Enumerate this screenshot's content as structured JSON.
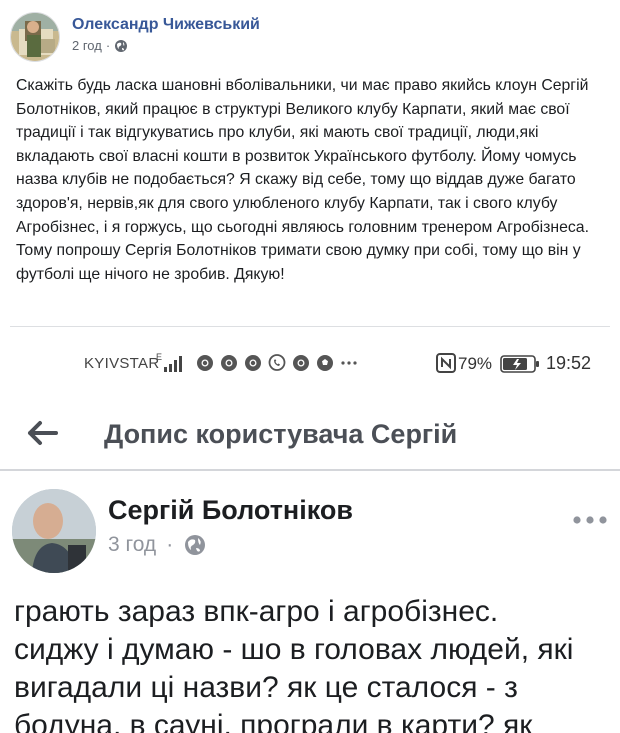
{
  "post": {
    "author": "Олександр Чижевський",
    "time": "2 год",
    "separator": "·",
    "privacy_icon": "globe-icon",
    "text": "Скажіть будь ласка шановні вболівальники, чи має право якийсь клоун Сергій Болотніков, який працює в структурі Великого клубу Карпати, який має свої традиції і так відгукуватись про клуби, які мають свої традиції, люди,які вкладають свої власні кошти в розвиток Українського футболу. Йому чомусь назва клубів не подобається? Я скажу від себе, тому що віддав дуже багато здоров'я, нервів,як для свого улюбленого клубу Карпати, так і свого клубу Агробізнес, і я горжусь, що сьогодні являюсь головним тренером Агробізнеса. Тому попрошу Сергія Болотніков тримати свою думку при собі, тому що він у футболі ще нічого не зробив. Дякую!"
  },
  "screenshot": {
    "status_bar": {
      "carrier": "KYIVSTAR",
      "network": "E",
      "battery": "79%",
      "time": "19:52"
    },
    "header": {
      "title": "Допис користувача Сергій"
    },
    "inner_post": {
      "author": "Сергій Болотніков",
      "time": "3 год",
      "separator": "·",
      "text_lines": [
        "грають зараз впк-агро і агробізнес.",
        "сиджу і думаю - шо в головах людей, які",
        "вигадали ці назви? як це сталося - з",
        "бодуна, в сауні, програли в карти? як"
      ]
    }
  }
}
